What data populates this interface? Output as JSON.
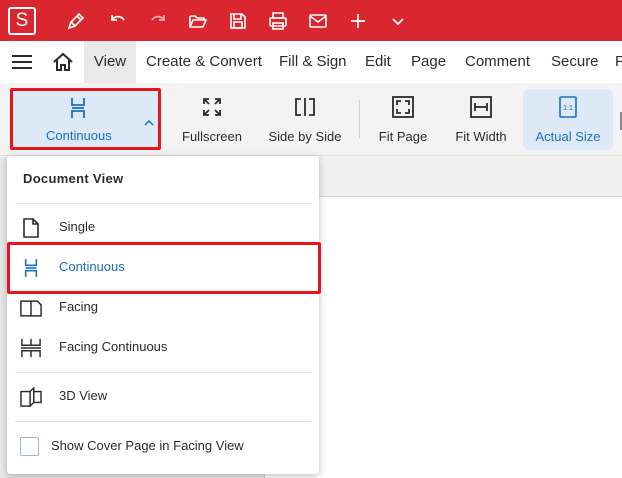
{
  "app": {
    "logo_letter": "S",
    "brand_color": "#d9262f",
    "accent_color": "#1a6fc1",
    "highlight_color": "#e6141b"
  },
  "quick_access": [
    {
      "name": "sign-pen-icon"
    },
    {
      "name": "undo-icon"
    },
    {
      "name": "redo-icon"
    },
    {
      "name": "open-folder-icon"
    },
    {
      "name": "save-icon"
    },
    {
      "name": "print-icon"
    },
    {
      "name": "email-icon"
    },
    {
      "name": "new-plus-icon"
    },
    {
      "name": "chevron-down-icon"
    }
  ],
  "menu": {
    "tabs": [
      "View",
      "Create & Convert",
      "Fill & Sign",
      "Edit",
      "Page",
      "Comment",
      "Secure",
      "F"
    ],
    "active_tab": "View"
  },
  "toolbar": {
    "continuous_label": "Continuous",
    "fullscreen_label": "Fullscreen",
    "side_by_side_label": "Side by Side",
    "fit_page_label": "Fit Page",
    "fit_width_label": "Fit Width",
    "actual_size_label": "Actual Size",
    "actual_size_icon_text": "1:1"
  },
  "dropdown": {
    "title": "Document View",
    "items": [
      {
        "label": "Single",
        "icon": "single-page-icon"
      },
      {
        "label": "Continuous",
        "icon": "continuous-icon",
        "selected": true
      },
      {
        "label": "Facing",
        "icon": "facing-icon"
      },
      {
        "label": "Facing Continuous",
        "icon": "facing-continuous-icon"
      },
      {
        "label": "3D View",
        "icon": "3d-view-icon"
      }
    ],
    "checkbox_label": "Show Cover Page in Facing View",
    "checkbox_checked": false
  }
}
